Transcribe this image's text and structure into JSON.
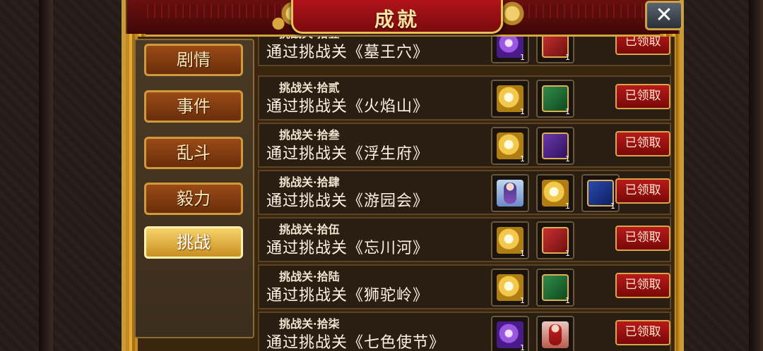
{
  "header": {
    "title": "成就",
    "close_label": "✕"
  },
  "tabs": [
    {
      "label": "剧情",
      "active": false
    },
    {
      "label": "事件",
      "active": false
    },
    {
      "label": "乱斗",
      "active": false
    },
    {
      "label": "毅力",
      "active": false
    },
    {
      "label": "挑战",
      "active": true
    }
  ],
  "achievements": [
    {
      "sub": "挑战关·拾壹",
      "title": "通过挑战关《墓王穴》",
      "rewards": [
        {
          "kind": "gem-purple",
          "qty": "1"
        },
        {
          "kind": "book-red",
          "qty": "1"
        }
      ],
      "status": "已领取"
    },
    {
      "sub": "挑战关·拾贰",
      "title": "通过挑战关《火焰山》",
      "rewards": [
        {
          "kind": "gem-gold",
          "qty": "1"
        },
        {
          "kind": "book-green",
          "qty": "1"
        }
      ],
      "status": "已领取"
    },
    {
      "sub": "挑战关·拾叁",
      "title": "通过挑战关《浮生府》",
      "rewards": [
        {
          "kind": "gem-gold",
          "qty": "1"
        },
        {
          "kind": "book-purple",
          "qty": "1"
        }
      ],
      "status": "已领取"
    },
    {
      "sub": "挑战关·拾肆",
      "title": "通过挑战关《游园会》",
      "rewards": [
        {
          "kind": "portrait-blue",
          "qty": ""
        },
        {
          "kind": "gem-gold",
          "qty": "1"
        },
        {
          "kind": "book-blue",
          "qty": "1"
        }
      ],
      "status": "已领取"
    },
    {
      "sub": "挑战关·拾伍",
      "title": "通过挑战关《忘川河》",
      "rewards": [
        {
          "kind": "gem-gold",
          "qty": "1"
        },
        {
          "kind": "book-red",
          "qty": "1"
        }
      ],
      "status": "已领取"
    },
    {
      "sub": "挑战关·拾陆",
      "title": "通过挑战关《狮驼岭》",
      "rewards": [
        {
          "kind": "gem-gold",
          "qty": "1"
        },
        {
          "kind": "book-green",
          "qty": "1"
        }
      ],
      "status": "已领取"
    },
    {
      "sub": "挑战关·拾柒",
      "title": "通过挑战关《七色使节》",
      "rewards": [
        {
          "kind": "gem-purple",
          "qty": "1"
        },
        {
          "kind": "portrait-red",
          "qty": ""
        }
      ],
      "status": "已领取"
    }
  ]
}
